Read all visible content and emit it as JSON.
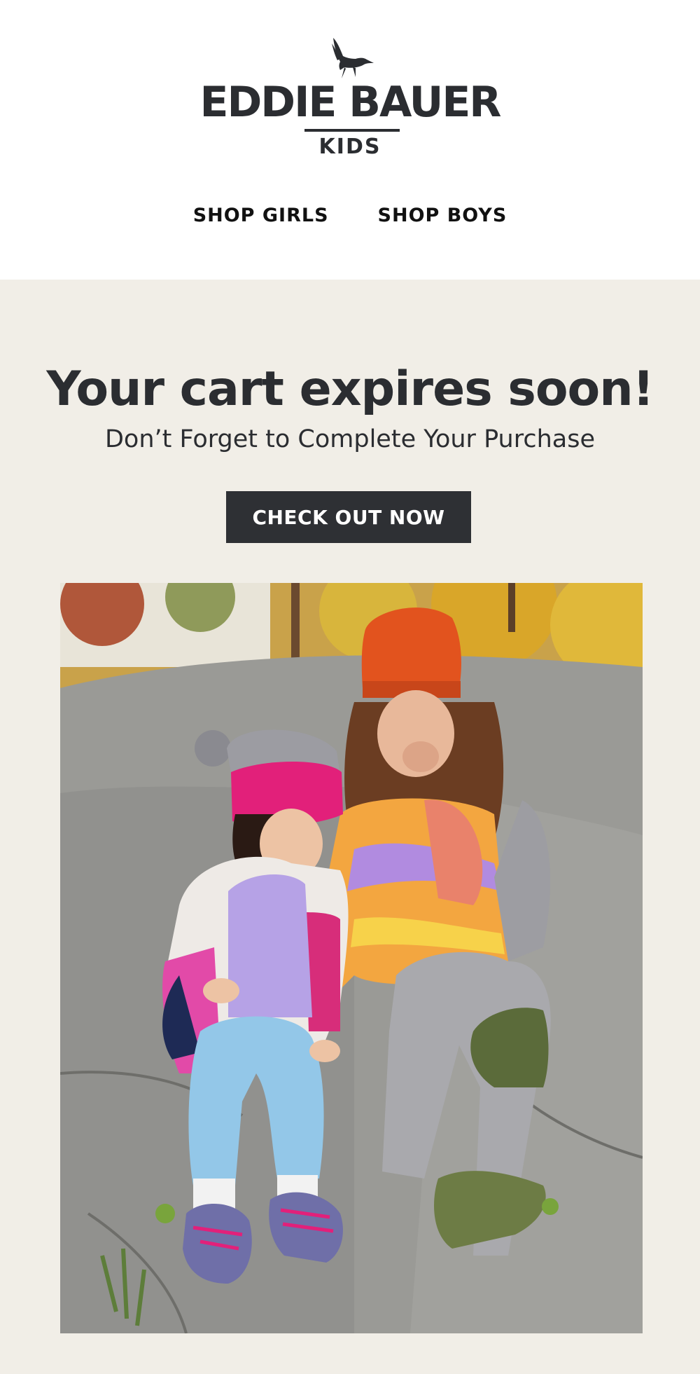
{
  "brand": {
    "name": "EDDIE BAUER",
    "sub": "KIDS",
    "logo_icon": "goose-icon",
    "color": "#2b2d31"
  },
  "nav": {
    "items": [
      {
        "label": "SHOP GIRLS"
      },
      {
        "label": "SHOP BOYS"
      }
    ]
  },
  "hero": {
    "background": "#f1eee7",
    "headline": "Your cart expires soon!",
    "subhead": "Don’t Forget to Complete Your Purchase",
    "cta_label": "CHECK OUT NOW",
    "cta_color": "#2e3034",
    "image_label": "two kids sitting on a rock in autumn wearing beanies and fleece jackets"
  }
}
